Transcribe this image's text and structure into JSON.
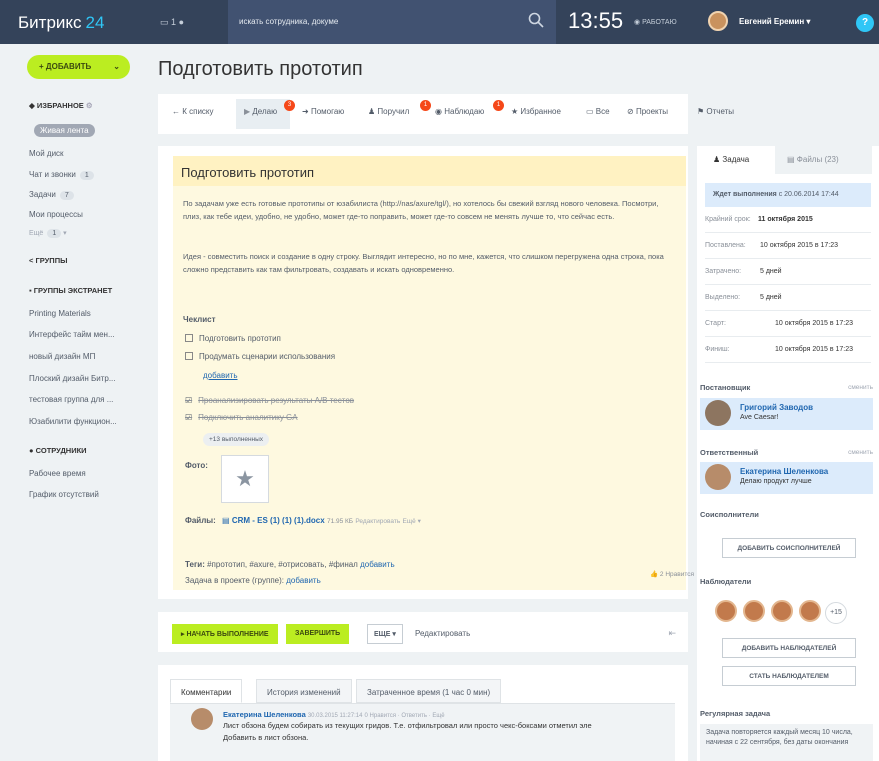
{
  "topbar": {
    "logo": "Битрикс",
    "logo_num": "24",
    "messages": "1",
    "search_placeholder": "искать сотрудника, докуме",
    "clock": "13:55",
    "status": "РАБОТАЮ",
    "user_name": "Евгений Еремин",
    "help": "?"
  },
  "sidebar": {
    "add_button": "+ ДОБАВИТЬ",
    "favorites": "ИЗБРАННОЕ",
    "live_feed": "Живая лента",
    "my_disk": "Мой диск",
    "chats": "Чат и звонки",
    "chats_count": "1",
    "tasks": "Задачи",
    "tasks_count": "7",
    "processes": "Мои процессы",
    "more": "Ещё",
    "more_count": "1",
    "groups": "ГРУППЫ",
    "extranet": "ГРУППЫ ЭКСТРАНЕТ",
    "groups_list": [
      "Printing Materials",
      "Интерфейс тайм мен...",
      "новый дизайн МП",
      "Плоский дизайн Битр...",
      "тестовая группа для ...",
      "Юзабилити функцион..."
    ],
    "employees": "СОТРУДНИКИ",
    "work_time": "Рабочее время",
    "absence": "График отсутствий"
  },
  "page_title": "Подготовить прототип",
  "tabs": {
    "back": "← К списку",
    "doing": "Делаю",
    "doing_badge": "3",
    "helping": "Помогаю",
    "assigned": "Поручил",
    "assigned_badge": "1",
    "watching": "Наблюдаю",
    "watching_badge": "1",
    "favorite": "Избранное",
    "all": "Все",
    "projects": "Проекты",
    "reports": "Отчеты"
  },
  "task": {
    "title": "Подготовить прототип",
    "desc1": "По задачам уже есть готовые прототипы от юзабилиста (http://nas/axure/tgl/), но хотелось бы свежий взгляд нового человека. Посмотри, плиз, как тебе идеи, удобно, не удобно, может где-то поправить, может где-то совсем не менять лучше то, что сейчас есть.",
    "desc2": "Идея - совместить поиск и создание в одну строку. Выглядит интересно, но по мне, кажется, что слишком перегружена одна строка, пока сложно представить как там фильтровать, создавать и искать одновременно.",
    "checklist_title": "Чеклист",
    "check1": "Подготовить прототип",
    "check2": "Продумать сценарии использования",
    "add_link": "добавить",
    "check3": "Проанализировать результаты A/B тестов",
    "check4": "Подключить аналитику GA",
    "done_more": "+13 выполненных",
    "photo_label": "Фото:",
    "files_label": "Файлы:",
    "file_name": "CRM - ES (1) (1) (1).docx",
    "file_size": "71.95 КБ",
    "file_edit": "Редактировать",
    "file_more": "Ещё",
    "tags_label": "Теги:",
    "tags": "#прототип, #axure, #отрисовать, #финал",
    "tags_add": "добавить",
    "project_label": "Задача в проекте (группе):",
    "project_add": "добавить",
    "likes": "2 Нравится"
  },
  "actions": {
    "start": "▸ НАЧАТЬ ВЫПОЛНЕНИЕ",
    "finish": "ЗАВЕРШИТЬ",
    "more": "ЕЩЕ",
    "edit": "Редактировать"
  },
  "comments": {
    "tab1": "Комментарии",
    "tab2": "История изменений",
    "tab3": "Затраченное время (1 час 0 мин)",
    "author": "Екатерина Шеленкова",
    "meta": "30.03.2015 11:27:14",
    "meta2": "0 Нравится · Ответить · Ещё",
    "text1": "Лист обзона будем собирать из текущих гридов. Т.е. отфильтровал или просто чекс-боксами отметил эле",
    "text2": "Добавить в лист обзона."
  },
  "right": {
    "tab_task": "Задача",
    "tab_files": "Файлы (23)",
    "status": "Ждет выполнения",
    "status_date": "с 20.06.2014 17:44",
    "deadline_label": "Крайний срок:",
    "deadline": "11 октября 2015",
    "set_label": "Поставлена:",
    "set_value": "10 октября 2015 в 17:23",
    "spent_label": "Затрачено:",
    "spent_value": "5 дней",
    "allotted_label": "Выделено:",
    "allotted_value": "5 дней",
    "start_label": "Старт:",
    "start_value": "10 октября 2015 в 17:23",
    "finish_label": "Финиш:",
    "finish_value": "10 октября 2015 в 17:23",
    "creator_h": "Постановщик",
    "change": "сменить",
    "creator_name": "Григорий Заводов",
    "creator_sub": "Ave Caesar!",
    "resp_h": "Ответственный",
    "resp_name": "Екатерина Шеленкова",
    "resp_sub": "Делаю продукт лучше",
    "co_h": "Соисполнители",
    "add_co": "ДОБАВИТЬ СОИСПОЛНИТЕЛЕЙ",
    "watchers_h": "Наблюдатели",
    "watchers_more": "+15",
    "add_watch": "ДОБАВИТЬ НАБЛЮДАТЕЛЕЙ",
    "become_watch": "СТАТЬ НАБЛЮДАТЕЛЕМ",
    "reg_h": "Регулярная задача",
    "reg_text": "Задача повторяется каждый месяц 10 числа, начиная с 22 сентября, без даты окончания"
  }
}
